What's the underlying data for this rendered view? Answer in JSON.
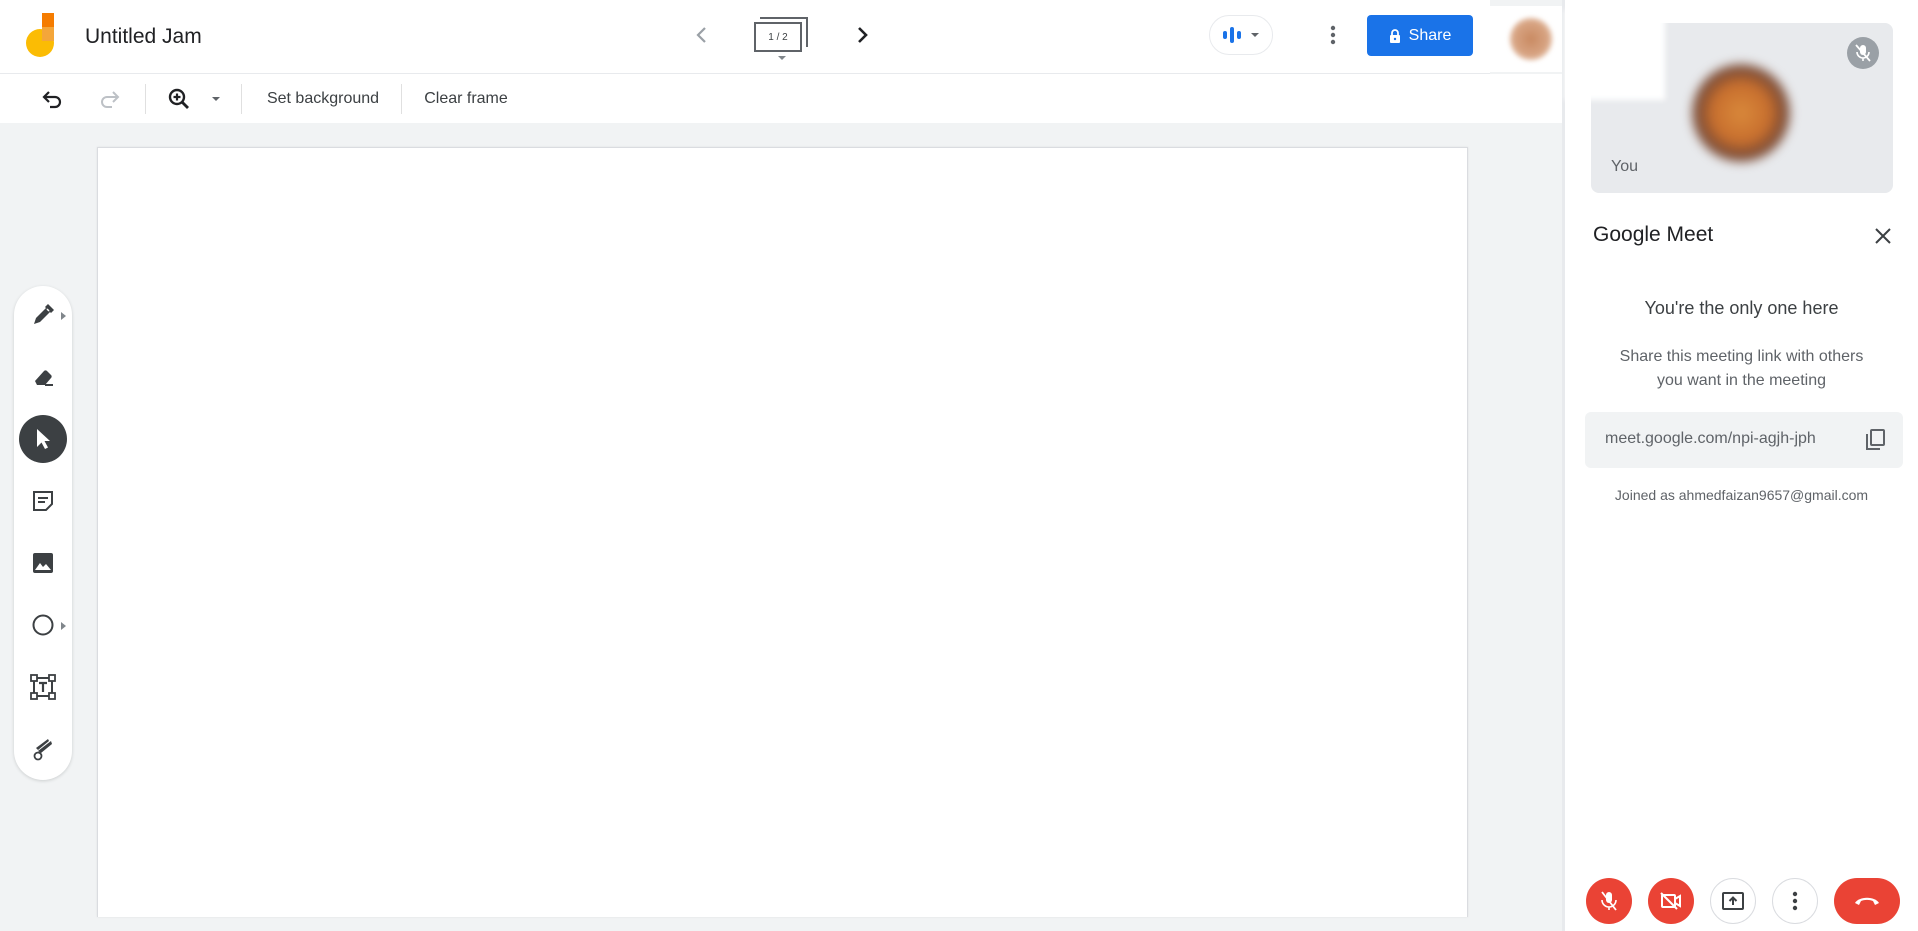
{
  "app": {
    "title": "Untitled Jam",
    "brand_colors": {
      "logo_yellow": "#fbbc04",
      "logo_orange": "#f57c00",
      "accent_blue": "#1a73e8",
      "danger_red": "#ea4335"
    }
  },
  "topbar": {
    "prev_frame_icon": "chevron-left-icon",
    "frame_indicator": "1 / 2",
    "next_frame_icon": "chevron-right-icon",
    "assistant_icon": "voice-bars-icon",
    "more_icon": "more-vert-icon",
    "share_label": "Share",
    "share_icon": "lock-icon"
  },
  "toolbar": {
    "undo_icon": "undo-icon",
    "redo_icon": "redo-icon",
    "zoom_icon": "zoom-in-icon",
    "set_background_label": "Set background",
    "clear_frame_label": "Clear frame"
  },
  "tools": [
    {
      "name": "pen",
      "icon": "marker-icon",
      "has_submenu": true,
      "active": false
    },
    {
      "name": "eraser",
      "icon": "eraser-icon",
      "has_submenu": false,
      "active": false
    },
    {
      "name": "select",
      "icon": "cursor-icon",
      "has_submenu": false,
      "active": true
    },
    {
      "name": "sticky-note",
      "icon": "sticky-note-icon",
      "has_submenu": false,
      "active": false
    },
    {
      "name": "image",
      "icon": "image-icon",
      "has_submenu": false,
      "active": false
    },
    {
      "name": "shape",
      "icon": "circle-icon",
      "has_submenu": true,
      "active": false
    },
    {
      "name": "text-box",
      "icon": "text-box-icon",
      "has_submenu": false,
      "active": false
    },
    {
      "name": "laser",
      "icon": "laser-icon",
      "has_submenu": false,
      "active": false
    }
  ],
  "meet_panel": {
    "self_label": "You",
    "self_muted_icon": "mic-off-icon",
    "title": "Google Meet",
    "close_icon": "close-icon",
    "heading": "You're the only one here",
    "hint": "Share this meeting link with others you want in the meeting",
    "meeting_link": "meet.google.com/npi-agjh-jph",
    "copy_icon": "copy-icon",
    "joined_as": "Joined as ahmedfaizan9657@gmail.com",
    "controls": [
      {
        "name": "microphone",
        "icon": "mic-off-icon",
        "state": "off"
      },
      {
        "name": "camera",
        "icon": "videocam-off-icon",
        "state": "off"
      },
      {
        "name": "present",
        "icon": "present-screen-icon",
        "state": "idle"
      },
      {
        "name": "more",
        "icon": "more-vert-icon",
        "state": "idle"
      },
      {
        "name": "leave-call",
        "icon": "call-end-icon",
        "state": "idle"
      }
    ]
  }
}
